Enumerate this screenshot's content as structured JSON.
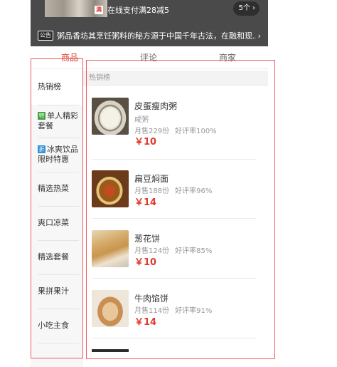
{
  "banner": {
    "promo_badge": "满",
    "promo_text": "在线支付满28减5",
    "promo_count": "5个",
    "notice_tag": "公告",
    "notice_text": "粥品香坊其烹饪粥料的秘方源于中国千年古法，在融和现..."
  },
  "tabs": [
    {
      "label": "商品",
      "active": true
    },
    {
      "label": "评论",
      "active": false
    },
    {
      "label": "商家",
      "active": false
    }
  ],
  "sidebar": {
    "items": [
      {
        "label": "热销榜",
        "tag": "",
        "tag_color": ""
      },
      {
        "label": "单人精彩套餐",
        "tag": "特",
        "tag_color": "#3ca13c"
      },
      {
        "label": "冰爽饮品限时特惠",
        "tag": "折",
        "tag_color": "#2f8fd8"
      },
      {
        "label": "精选热菜",
        "tag": "",
        "tag_color": ""
      },
      {
        "label": "爽口凉菜",
        "tag": "",
        "tag_color": ""
      },
      {
        "label": "精选套餐",
        "tag": "",
        "tag_color": ""
      },
      {
        "label": "果拼果汁",
        "tag": "",
        "tag_color": ""
      },
      {
        "label": "小吃主食",
        "tag": "",
        "tag_color": ""
      }
    ]
  },
  "menu": {
    "section_title": "热销榜",
    "foods": [
      {
        "name": "皮蛋瘦肉粥",
        "desc": "咸粥",
        "sales": "月售229份",
        "rating": "好评率100%",
        "price": "￥10",
        "image": "porridge"
      },
      {
        "name": "扁豆焖面",
        "desc": "",
        "sales": "月售188份",
        "rating": "好评率96%",
        "price": "￥14",
        "image": "noodle"
      },
      {
        "name": "葱花饼",
        "desc": "",
        "sales": "月售124份",
        "rating": "好评率85%",
        "price": "￥10",
        "image": "pancake"
      },
      {
        "name": "牛肉馅饼",
        "desc": "",
        "sales": "月售114份",
        "rating": "好评率91%",
        "price": "￥14",
        "image": "meatpie"
      }
    ]
  },
  "colors": {
    "accent": "#e03b2e",
    "annotation": "#f05a5a",
    "banner_bg": "#4a4a4a"
  }
}
